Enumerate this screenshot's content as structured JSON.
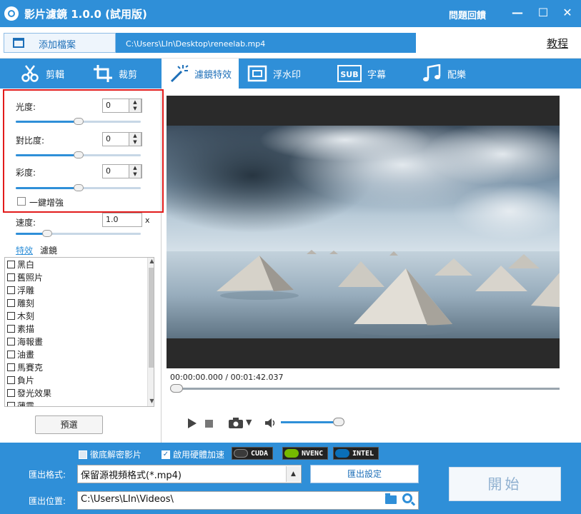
{
  "app": {
    "title": "影片濾鏡 1.0.0 (試用版)",
    "feedback": "問題回饋",
    "minimize": "—",
    "maximize": "☐",
    "close": "✕"
  },
  "filebar": {
    "add_file": "添加檔案",
    "file_path": "C:\\Users\\LIn\\Desktop\\reneelab.mp4",
    "tutorial": "教程"
  },
  "tabs": [
    {
      "label": "剪輯",
      "icon": "scissors-icon"
    },
    {
      "label": "裁剪",
      "icon": "crop-icon"
    },
    {
      "label": "濾鏡特效",
      "icon": "magic-wand-icon"
    },
    {
      "label": "浮水印",
      "icon": "watermark-icon"
    },
    {
      "label": "字幕",
      "icon": "subtitle-icon"
    },
    {
      "label": "配樂",
      "icon": "music-note-icon"
    }
  ],
  "adjust": {
    "brightness_label": "光度:",
    "brightness_value": "0",
    "brightness_level": 0.5,
    "contrast_label": "對比度:",
    "contrast_value": "0",
    "contrast_level": 0.5,
    "saturation_label": "彩度:",
    "saturation_value": "0",
    "saturation_level": 0.5,
    "enhance_label": "一鍵增強",
    "speed_label": "速度:",
    "speed_value": "1.0",
    "speed_unit": "x",
    "speed_level": 0.25
  },
  "fx_tabs": {
    "effects": "特效",
    "filters": "濾鏡"
  },
  "fx_items": [
    "黑白",
    "舊照片",
    "浮雕",
    "雕刻",
    "木刻",
    "素描",
    "海報畫",
    "油畫",
    "馬賽克",
    "負片",
    "發光效果",
    "薄霧"
  ],
  "preset_button": "預選",
  "player": {
    "time": "00:00:00.000 / 00:01:42.037",
    "progress": 0.0,
    "volume": 0.9
  },
  "bottom": {
    "deinterlace_label": "徹底解密影片",
    "hw_accel_label": "啟用硬體加速",
    "hw_accel_checked": "✓",
    "badges": [
      {
        "label": "CUDA"
      },
      {
        "label": "NVENC"
      },
      {
        "label": "INTEL"
      }
    ],
    "format_label": "匯出格式:",
    "format_value": "保留源視頻格式(*.mp4)",
    "export_settings": "匯出設定",
    "location_label": "匯出位置:",
    "location_value": "C:\\Users\\LIn\\Videos\\",
    "start": "開始"
  },
  "colors": {
    "accent": "#2f8fd8",
    "highlight_border": "#e21b1b"
  }
}
